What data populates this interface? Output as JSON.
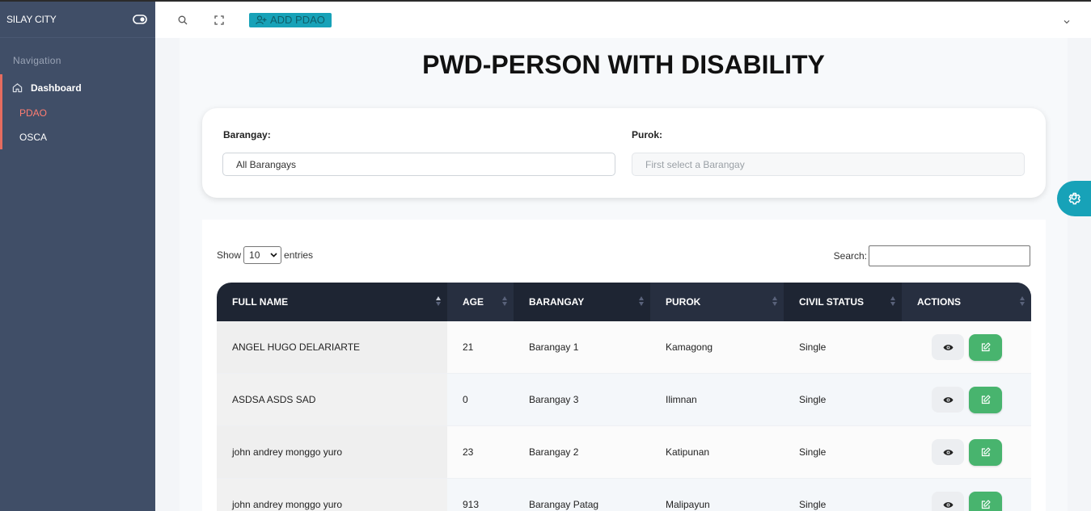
{
  "app": {
    "brand": "SILAY CITY"
  },
  "sidebar": {
    "caption": "Navigation",
    "items": [
      {
        "label": "Dashboard",
        "icon": "home-icon"
      },
      {
        "label": "PDAO",
        "active": true
      },
      {
        "label": "OSCA"
      }
    ],
    "accent_color": "#e56c5f"
  },
  "header": {
    "add_button": "ADD PDAO",
    "icons": [
      "search-icon",
      "expand-icon",
      "chevron-down-icon"
    ]
  },
  "page": {
    "title": "PWD-PERSON WITH DISABILITY"
  },
  "filters": {
    "barangay_label": "Barangay:",
    "barangay_value": "All Barangays",
    "purok_label": "Purok:",
    "purok_placeholder": "First select a Barangay"
  },
  "table_controls": {
    "show_label": "Show",
    "entries_value": "10",
    "entries_label": "entries",
    "search_label": "Search:"
  },
  "table": {
    "columns": [
      "FULL NAME",
      "AGE",
      "BARANGAY",
      "PUROK",
      "CIVIL STATUS",
      "ACTIONS"
    ],
    "rows": [
      {
        "name": "ANGEL HUGO DELARIARTE",
        "age": "21",
        "barangay": "Barangay 1",
        "purok": "Kamagong",
        "civil": "Single"
      },
      {
        "name": "ASDSA ASDS SAD",
        "age": "0",
        "barangay": "Barangay 3",
        "purok": "Ilimnan",
        "civil": "Single"
      },
      {
        "name": "john andrey monggo yuro",
        "age": "23",
        "barangay": "Barangay 2",
        "purok": "Katipunan",
        "civil": "Single"
      },
      {
        "name": "john andrey monggo yuro",
        "age": "913",
        "barangay": "Barangay Patag",
        "purok": "Malipayun",
        "civil": "Single"
      }
    ]
  },
  "colors": {
    "teal": "#17a2b8",
    "edit_green": "#48b46e",
    "header_dark": "#1e2533",
    "sidebar": "#404e67"
  }
}
